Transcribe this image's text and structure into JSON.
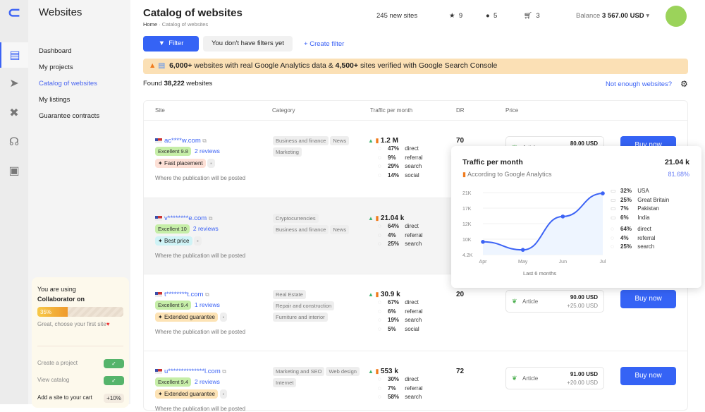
{
  "app": {
    "title": "Websites"
  },
  "nav": [
    "Dashboard",
    "My projects",
    "Catalog of websites",
    "My listings",
    "Guarantee contracts"
  ],
  "promo": {
    "line1": "You are using",
    "line2": "Collaborator on",
    "progress_label": "35%",
    "progress": 35,
    "hint": "Great, choose your first site",
    "steps": [
      {
        "label": "Create a project",
        "done": "✓"
      },
      {
        "label": "View catalog",
        "done": "✓"
      },
      {
        "label": "Add a site to your cart",
        "bonus": "+10%"
      }
    ]
  },
  "header": {
    "title": "Catalog of websites",
    "breadcrumb": [
      "Home",
      "Catalog of websites"
    ],
    "new_sites": "245 new sites",
    "favorites": "9",
    "messages": "5",
    "cart": "3",
    "balance_label": "Balance",
    "balance": "3 567.00 USD"
  },
  "filters": {
    "filter": "Filter",
    "none": "You don't have filters yet",
    "create": "Create filter"
  },
  "banner": {
    "a": "6,000+",
    "b": " websites with real Google Analytics data & ",
    "c": "4,500+",
    "d": " sites verified with Google Search Console"
  },
  "found": {
    "prefix": "Found",
    "count": "38,222",
    "suffix": "websites",
    "not_enough": "Not enough websites?"
  },
  "columns": [
    "Site",
    "Category",
    "Traffic per month",
    "DR",
    "Price"
  ],
  "where": "Where the publication will be posted",
  "rows": [
    {
      "domain": "ac****w.com",
      "rating": "Excellent 9.8",
      "reviews": "2 reviews",
      "feature": "Fast placement",
      "categories": [
        "Business and finance",
        "News",
        "Marketing"
      ],
      "traffic": "1.2 M",
      "sources": [
        [
          "47%",
          "direct"
        ],
        [
          "9%",
          "referral"
        ],
        [
          "29%",
          "search"
        ],
        [
          "14%",
          "social"
        ]
      ],
      "dr": "70",
      "type": "Article",
      "price": "80.00 USD",
      "extra": "",
      "buy": "Buy now"
    },
    {
      "domain": "v********e.com",
      "rating": "Excellent 10",
      "reviews": "2 reviews",
      "feature": "Best price",
      "categories": [
        "Cryptocurrencies",
        "Business and finance",
        "News"
      ],
      "traffic": "21.04 k",
      "sources": [
        [
          "64%",
          "direct"
        ],
        [
          "4%",
          "referral"
        ],
        [
          "25%",
          "search"
        ]
      ],
      "dr": "",
      "type": "",
      "price": "",
      "extra": "",
      "buy": ""
    },
    {
      "domain": "t********t.com",
      "rating": "Excellent 9.4",
      "reviews": "1 reviews",
      "feature": "Extended guarantee",
      "categories": [
        "Real Estate",
        "Repair and construction",
        "Furniture and interior"
      ],
      "traffic": "30.9 k",
      "sources": [
        [
          "67%",
          "direct"
        ],
        [
          "6%",
          "referral"
        ],
        [
          "19%",
          "search"
        ],
        [
          "5%",
          "social"
        ]
      ],
      "dr": "20",
      "type": "Article",
      "price": "90.00 USD",
      "extra": "+25.00 USD",
      "buy": "Buy now"
    },
    {
      "domain": "u**************l.com",
      "rating": "Excellent 9.4",
      "reviews": "2 reviews",
      "feature": "Extended guarantee",
      "categories": [
        "Marketing and SEO",
        "Web design",
        "Internet"
      ],
      "traffic": "553 k",
      "sources": [
        [
          "30%",
          "direct"
        ],
        [
          "7%",
          "referral"
        ],
        [
          "58%",
          "search"
        ]
      ],
      "dr": "72",
      "type": "Article",
      "price": "91.00 USD",
      "extra": "+20.00 USD",
      "buy": "Buy now"
    }
  ],
  "tooltip": {
    "title": "Traffic per month",
    "value": "21.04 k",
    "subtitle": "According to Google Analytics",
    "share": "81.68%",
    "period": "Last 6 months",
    "countries": [
      [
        "32%",
        "USA"
      ],
      [
        "25%",
        "Great Britain"
      ],
      [
        "7%",
        "Pakistan"
      ],
      [
        "6%",
        "India"
      ]
    ],
    "sources": [
      [
        "64%",
        "direct"
      ],
      [
        "4%",
        "referral"
      ],
      [
        "25%",
        "search"
      ]
    ]
  },
  "chart_data": {
    "type": "line",
    "title": "Traffic per month",
    "xlabel": "Last 6 months",
    "categories": [
      "Apr",
      "May",
      "Jun",
      "Jul"
    ],
    "values": [
      9.0,
      6.0,
      14.3,
      20.8
    ],
    "yticks": [
      "21K",
      "17K",
      "12K",
      "10K",
      "4.2K"
    ],
    "ytick_values": [
      21,
      17,
      12,
      10,
      4.2
    ],
    "colors": {
      "line": "#3c63f5"
    }
  }
}
